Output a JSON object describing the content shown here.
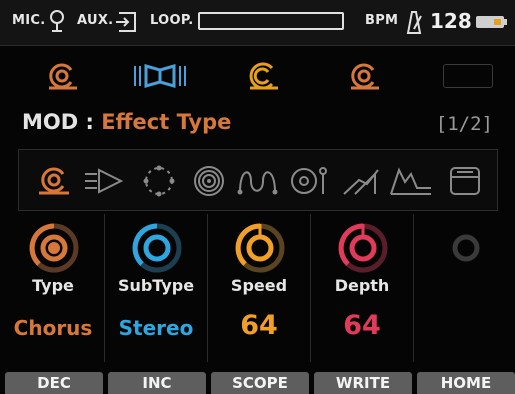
{
  "statusbar": {
    "mic_label": "MIC.",
    "aux_label": "AUX.",
    "loop_label": "LOOP.",
    "bpm_label": "BPM",
    "bpm_value": "128"
  },
  "chain": {
    "slots": [
      {
        "icon": "chorus-effect-icon",
        "color": "#d7783a"
      },
      {
        "icon": "phaser-effect-icon",
        "color": "#4aa0d8"
      },
      {
        "icon": "modulation-effect-icon",
        "color": "#e6a019"
      },
      {
        "icon": "chorus-effect-icon",
        "color": "#d7783a"
      },
      {
        "icon": "empty-slot",
        "color": "#3a3a3a"
      }
    ]
  },
  "mod": {
    "label": "MOD :",
    "value": "Effect Type",
    "page": "[1/2]"
  },
  "effect_types": [
    {
      "icon": "chorus-icon",
      "selected": true
    },
    {
      "icon": "flanger-arrow-icon",
      "selected": false
    },
    {
      "icon": "dotted-circle-icon",
      "selected": false
    },
    {
      "icon": "spiral-icon",
      "selected": false
    },
    {
      "icon": "wave-icon",
      "selected": false
    },
    {
      "icon": "rotary-icon",
      "selected": false
    },
    {
      "icon": "filter-icon",
      "selected": false
    },
    {
      "icon": "envelope-icon",
      "selected": false
    },
    {
      "icon": "box-icon",
      "selected": false
    }
  ],
  "params": [
    {
      "name": "Type",
      "value": "Chorus",
      "color": "#d7783a",
      "big": false
    },
    {
      "name": "SubType",
      "value": "Stereo",
      "color": "#2ea7e0",
      "big": false
    },
    {
      "name": "Speed",
      "value": "64",
      "color": "#f0a028",
      "big": true
    },
    {
      "name": "Depth",
      "value": "64",
      "color": "#e23a5a",
      "big": true
    },
    {
      "name": "",
      "value": "",
      "color": "#3a3a3a",
      "big": false
    }
  ],
  "buttons": [
    "DEC",
    "INC",
    "SCOPE",
    "WRITE",
    "HOME"
  ]
}
